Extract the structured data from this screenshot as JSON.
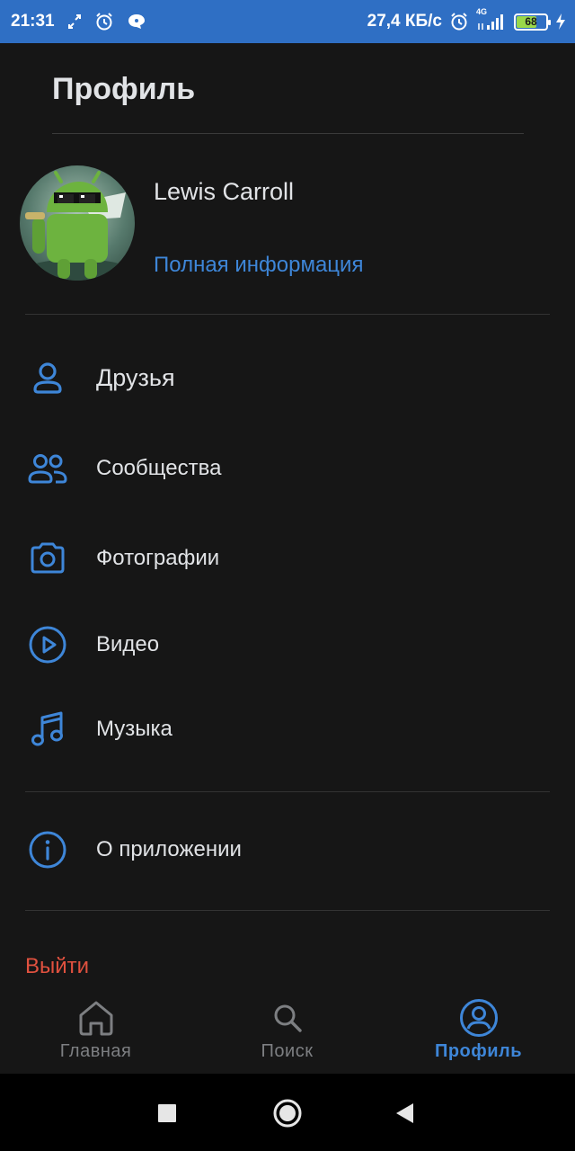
{
  "status_bar": {
    "time": "21:31",
    "net_speed": "27,4 КБ/с",
    "network": "4G",
    "battery": "68",
    "battery_level": 0.68
  },
  "header": {
    "title": "Профиль"
  },
  "profile": {
    "name": "Lewis Carroll",
    "full_info_link": "Полная информация"
  },
  "menu": {
    "friends": {
      "label": "Друзья",
      "icon": "person-icon"
    },
    "communities": {
      "label": "Сообщества",
      "icon": "people-icon"
    },
    "photos": {
      "label": "Фотографии",
      "icon": "camera-icon"
    },
    "video": {
      "label": "Видео",
      "icon": "play-circle-icon"
    },
    "music": {
      "label": "Музыка",
      "icon": "music-note-icon"
    },
    "about": {
      "label": "О приложении",
      "icon": "info-icon"
    }
  },
  "logout_label": "Выйти",
  "bottom_nav": {
    "home": {
      "label": "Главная",
      "icon": "home-icon"
    },
    "search": {
      "label": "Поиск",
      "icon": "search-icon"
    },
    "profile": {
      "label": "Профиль",
      "icon": "profile-icon",
      "active": true
    }
  },
  "colors": {
    "accent": "#3e86d8",
    "background": "#161616",
    "status_bar": "#2f6fc4",
    "logout": "#e0513f",
    "inactive": "#7d7f82"
  }
}
